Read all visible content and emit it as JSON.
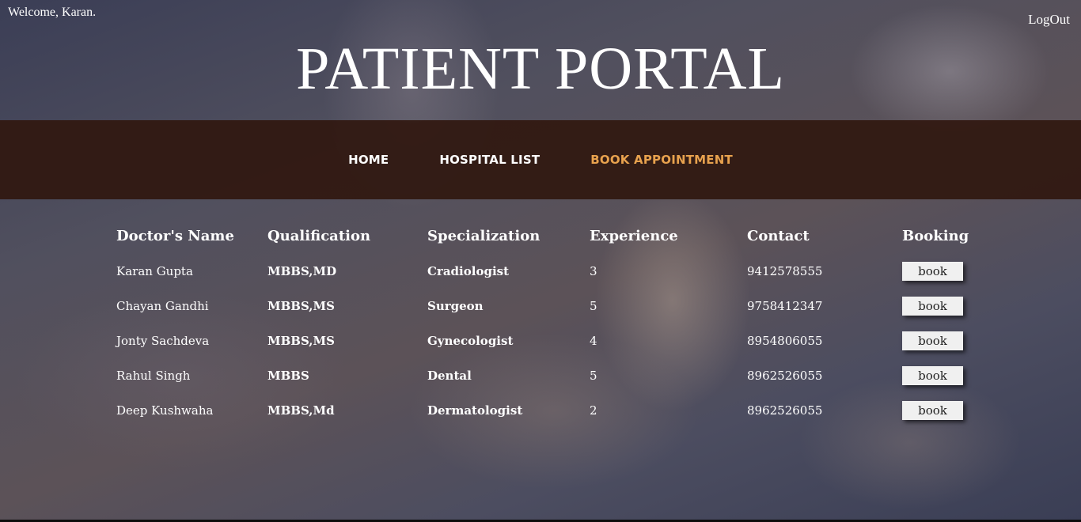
{
  "header": {
    "welcome": "Welcome, Karan.",
    "logout": "LogOut",
    "title": "PATIENT PORTAL"
  },
  "nav": {
    "items": [
      {
        "label": "HOME"
      },
      {
        "label": "HOSPITAL LIST"
      },
      {
        "label": "BOOK APPOINTMENT"
      }
    ],
    "active_color": "#e8a24e"
  },
  "table": {
    "headers": [
      "Doctor's Name",
      "Qualification",
      "Specialization",
      "Experience",
      "Contact",
      "Booking"
    ],
    "rows": [
      {
        "name": "Karan Gupta",
        "qualification": "MBBS,MD",
        "specialization": "Cradiologist",
        "experience": "3",
        "contact": "9412578555",
        "action": "book"
      },
      {
        "name": "Chayan Gandhi",
        "qualification": "MBBS,MS",
        "specialization": "Surgeon",
        "experience": "5",
        "contact": "9758412347",
        "action": "book"
      },
      {
        "name": "Jonty Sachdeva",
        "qualification": "MBBS,MS",
        "specialization": "Gynecologist",
        "experience": "4",
        "contact": "8954806055",
        "action": "book"
      },
      {
        "name": "Rahul Singh",
        "qualification": "MBBS",
        "specialization": "Dental",
        "experience": "5",
        "contact": "8962526055",
        "action": "book"
      },
      {
        "name": "Deep Kushwaha",
        "qualification": "MBBS,Md",
        "specialization": "Dermatologist",
        "experience": "2",
        "contact": "8962526055",
        "action": "book"
      }
    ]
  }
}
